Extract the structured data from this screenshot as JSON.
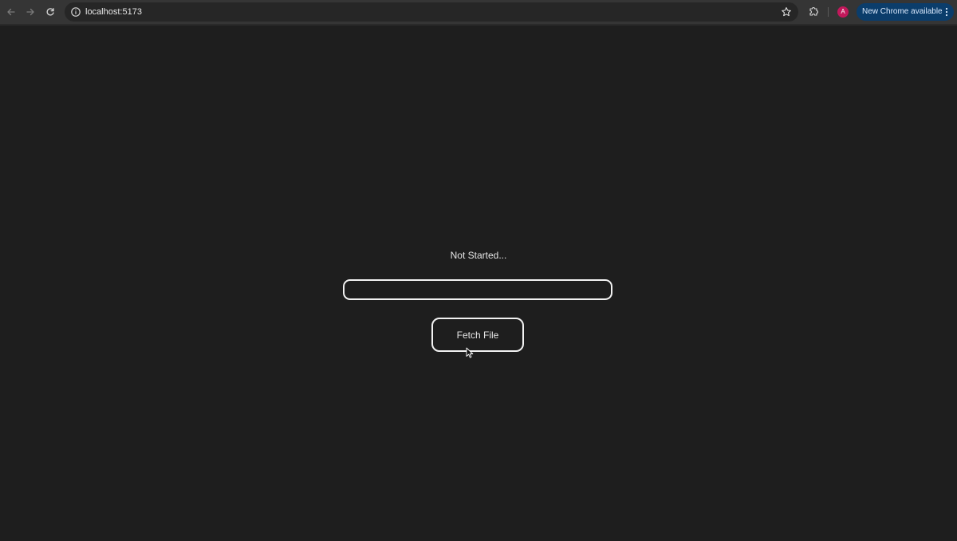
{
  "browser": {
    "url": "localhost:5173",
    "update_label": "New Chrome available",
    "profile_initial": "A",
    "profile_color": "#c2185b",
    "icons": {
      "back": "arrow-left",
      "forward": "arrow-right",
      "reload": "reload",
      "site_info": "info-circle",
      "bookmark": "star-outline",
      "extensions": "puzzle-piece",
      "menu": "kebab-vertical"
    }
  },
  "app": {
    "status": "Not Started...",
    "input_value": "",
    "input_placeholder": "",
    "fetch_label": "Fetch File",
    "background_color": "#1e1e1e",
    "border_color": "#f2f2f2"
  }
}
